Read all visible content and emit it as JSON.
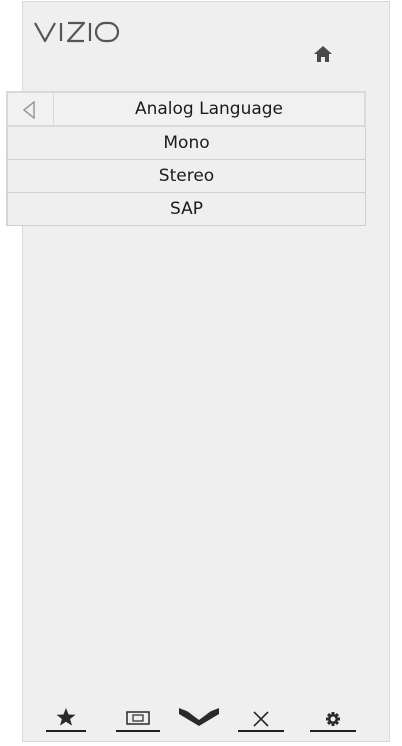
{
  "brand": {
    "logo_text": "VIZIO"
  },
  "header": {
    "home_icon": "home-icon"
  },
  "menu": {
    "title": "Analog Language",
    "back_icon": "back-triangle-icon",
    "items": [
      {
        "label": "Mono"
      },
      {
        "label": "Stereo"
      },
      {
        "label": "SAP"
      }
    ]
  },
  "bottom_bar": {
    "buttons": [
      {
        "icon": "star-icon"
      },
      {
        "icon": "picture-size-icon"
      },
      {
        "icon": "chevron-down-icon"
      },
      {
        "icon": "close-icon"
      },
      {
        "icon": "gear-icon"
      }
    ]
  },
  "colors": {
    "panel_bg": "#efefef",
    "border": "#d9d9d9",
    "text": "#1b1b1b",
    "icon": "#2a2a2a"
  }
}
